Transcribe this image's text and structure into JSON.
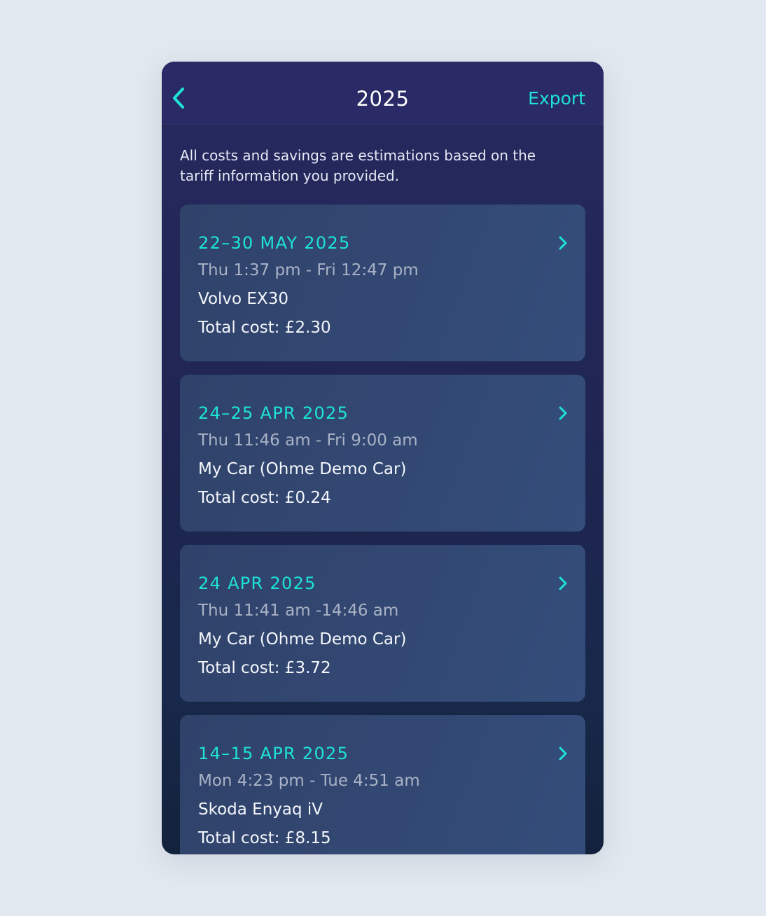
{
  "header": {
    "title": "2025",
    "export_label": "Export",
    "back_icon": "chevron-left-icon"
  },
  "notice": "All costs and savings are estimations based on the tariff information you provided.",
  "colors": {
    "accent": "#1ee3d6",
    "background": "#e2e8ef",
    "header": "#2a2b66",
    "card": "#344d7a"
  },
  "sessions": [
    {
      "date": "22–30 MAY 2025",
      "time": "Thu 1:37 pm - Fri 12:47 pm",
      "car": "Volvo EX30",
      "cost": "Total cost: £2.30",
      "icon": "chevron-right-icon"
    },
    {
      "date": "24–25 APR 2025",
      "time": "Thu 11:46 am - Fri 9:00 am",
      "car": "My Car (Ohme Demo Car)",
      "cost": "Total cost: £0.24",
      "icon": "chevron-right-icon"
    },
    {
      "date": "24 APR 2025",
      "time": "Thu 11:41 am -14:46 am",
      "car": "My Car (Ohme Demo Car)",
      "cost": "Total cost: £3.72",
      "icon": "chevron-right-icon"
    },
    {
      "date": "14–15 APR 2025",
      "time": "Mon 4:23 pm - Tue 4:51 am",
      "car": "Skoda Enyaq iV",
      "cost": "Total cost: £8.15",
      "icon": "chevron-right-icon"
    }
  ]
}
